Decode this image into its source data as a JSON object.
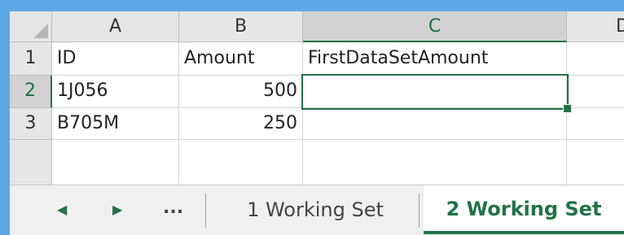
{
  "columns": [
    "A",
    "B",
    "C",
    "D"
  ],
  "rows": [
    {
      "num": "1",
      "a": "ID",
      "b": "Amount",
      "c": "FirstDataSetAmount"
    },
    {
      "num": "2",
      "a": "1J056",
      "b": "500",
      "c": ""
    },
    {
      "num": "3",
      "a": "B705M",
      "b": "250",
      "c": ""
    }
  ],
  "selected_cell": "C2",
  "sheet_tabs": {
    "prev_icon": "triangle-left-icon",
    "next_icon": "triangle-right-icon",
    "more_label": "...",
    "tabs": [
      {
        "label": "1 Working Set",
        "active": false
      },
      {
        "label": "2 Working Set",
        "active": true
      }
    ]
  },
  "colors": {
    "accent": "#217346",
    "desktop": "#5fa8e6"
  }
}
